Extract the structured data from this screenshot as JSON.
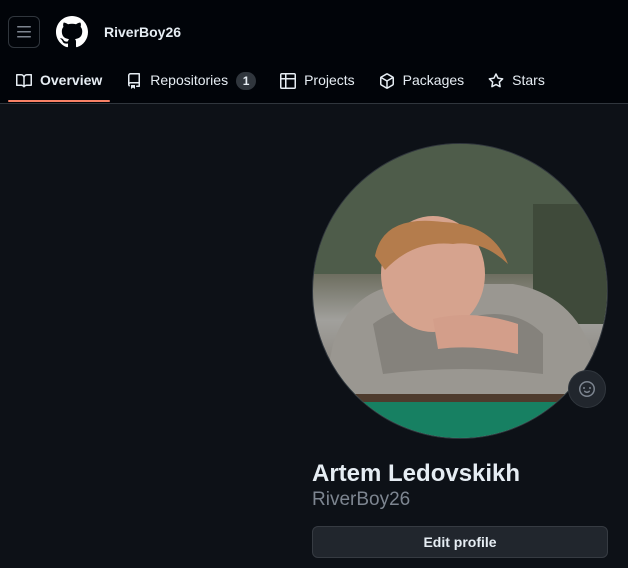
{
  "header": {
    "username": "RiverBoy26",
    "menu_icon": "hamburger-icon",
    "logo_icon": "github-mark-icon"
  },
  "tabs": [
    {
      "label": "Overview",
      "icon": "book-icon",
      "active": true
    },
    {
      "label": "Repositories",
      "icon": "repo-icon",
      "count": "1"
    },
    {
      "label": "Projects",
      "icon": "table-icon"
    },
    {
      "label": "Packages",
      "icon": "package-icon"
    },
    {
      "label": "Stars",
      "icon": "star-icon"
    }
  ],
  "profile": {
    "full_name": "Artem Ledovskikh",
    "login": "RiverBoy26",
    "edit_label": "Edit profile",
    "status_icon": "smiley-icon"
  },
  "colors": {
    "background": "#0d1117",
    "header_bg": "#010409",
    "active_underline": "#f78166",
    "muted_text": "#7d8590"
  }
}
